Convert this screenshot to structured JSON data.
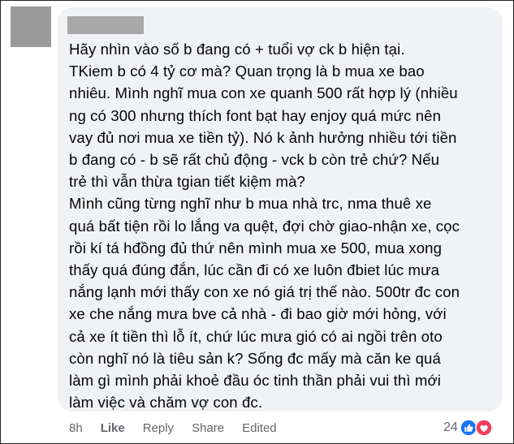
{
  "comment": {
    "lines": [
      "Hãy nhìn vào số b đang có + tuổi vợ ck b hiện tại.",
      "TKiem b có 4 tỷ cơ mà? Quan trọng là b mua xe bao",
      "nhiêu. Mình nghĩ mua con xe quanh 500 rất hợp lý (nhiều",
      "ng có 300 nhưng thích font bạt hay enjoy quá mức nên",
      "vay đủ nơi mua xe tiền tỷ). Nó k ảnh hưởng nhiều tới tiền",
      "b đang có - b sẽ rất chủ động - vck b còn trẻ chứ? Nếu",
      "trẻ thì vẫn thừa tgian tiết kiệm mà?",
      "Mình cũng từng nghĩ như b mua nhà trc, nma thuê xe",
      "quá bất tiện rồi lo lắng va quệt, đợi chờ giao-nhận xe, cọc",
      "rồi kí tá hđồng đủ thứ nên mình mua xe 500, mua xong",
      "thấy quá đúng đắn, lúc cần đi có xe luôn đbiet lúc mưa",
      "nắng lạnh mới thấy con xe nó giá trị thế nào. 500tr đc con",
      "xe che nắng mưa bve cả nhà - đi bao giờ mới hỏng, với",
      "cả xe ít tiền thì lỗ ít, chứ lúc mưa gió có ai ngồi trên oto",
      "còn nghĩ nó là tiêu sản k? Sống đc mấy mà căn ke quá",
      "làm gì mình phải khoẻ đầu óc tinh thần phải vui thì mới",
      "làm việc và chăm vợ con đc."
    ]
  },
  "actions": {
    "time": "8h",
    "like": "Like",
    "reply": "Reply",
    "share": "Share",
    "edited": "Edited"
  },
  "reactions": {
    "count": "24",
    "icons": [
      "like-reaction-icon",
      "love-reaction-icon"
    ],
    "like_color": "#1877f2",
    "love_color": "#f33e58"
  }
}
